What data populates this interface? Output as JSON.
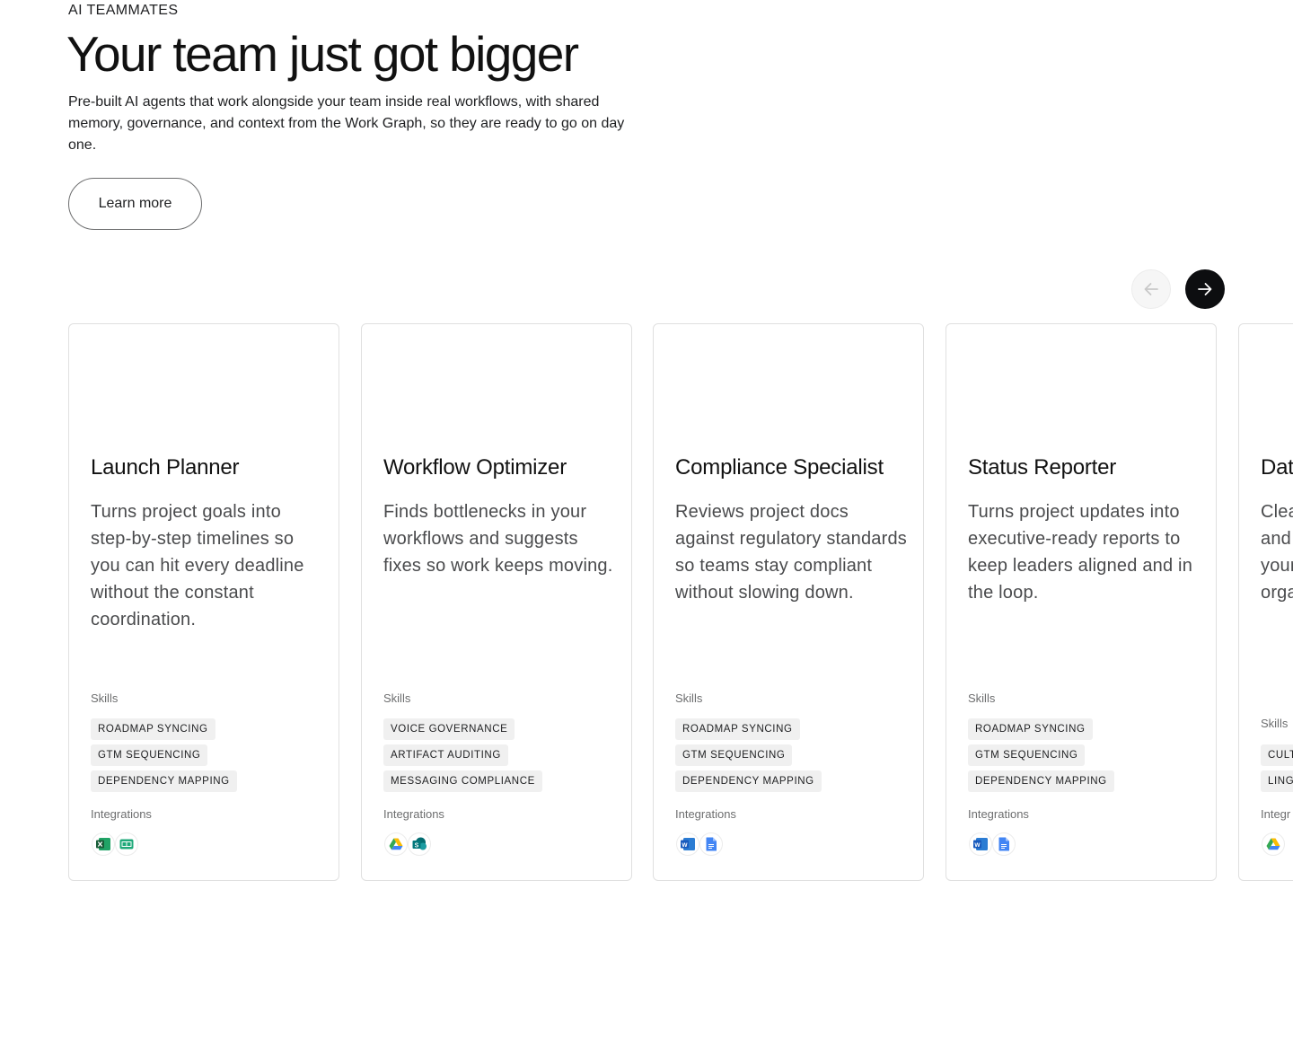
{
  "hero": {
    "eyebrow": "AI TEAMMATES",
    "title": "Your team just got bigger",
    "description": "Pre-built AI agents that work alongside your team inside real workflows, with shared memory, governance, and context from the Work Graph, so they are ready to go on day one.",
    "cta_label": "Learn more"
  },
  "carousel": {
    "prev_icon": "arrow-left-icon",
    "next_icon": "arrow-right-icon",
    "skills_label": "Skills",
    "integrations_label": "Integrations",
    "cards": [
      {
        "title": "Launch Planner",
        "description": "Turns project goals into step-by-step timelines so you can hit every deadline without the constant coordination.",
        "skills": [
          "ROADMAP SYNCING",
          "GTM SEQUENCING",
          "DEPENDENCY MAPPING"
        ],
        "integrations": [
          "excel-icon",
          "sheets-icon"
        ]
      },
      {
        "title": "Workflow Optimizer",
        "description": "Finds bottlenecks in your workflows and suggests fixes so work keeps moving.",
        "skills": [
          "VOICE GOVERNANCE",
          "ARTIFACT AUDITING",
          "MESSAGING COMPLIANCE"
        ],
        "integrations": [
          "google-drive-icon",
          "sharepoint-icon"
        ]
      },
      {
        "title": "Compliance Specialist",
        "description": "Reviews project docs against regulatory standards so teams stay compliant without slowing down.",
        "skills": [
          "ROADMAP SYNCING",
          "GTM SEQUENCING",
          "DEPENDENCY MAPPING"
        ],
        "integrations": [
          "word-icon",
          "google-docs-icon"
        ]
      },
      {
        "title": "Status Reporter",
        "description": "Turns project updates into executive-ready reports to keep leaders aligned and in the loop.",
        "skills": [
          "ROADMAP SYNCING",
          "GTM SEQUENCING",
          "DEPENDENCY MAPPING"
        ],
        "integrations": [
          "word-icon",
          "google-docs-icon"
        ]
      },
      {
        "title": "Dat",
        "description_lines": [
          "Clea",
          "and",
          "your",
          "orga"
        ],
        "skills": [
          "CULT",
          "LING"
        ],
        "integrations": [
          "google-drive-icon"
        ],
        "integrations_label": "Integr"
      }
    ]
  },
  "colors": {
    "text": "#1e1f21",
    "muted": "#6d6e6f",
    "tag_bg": "#f0f0f0",
    "card_border": "#e0e0e0",
    "nav_active": "#0d0e10"
  }
}
